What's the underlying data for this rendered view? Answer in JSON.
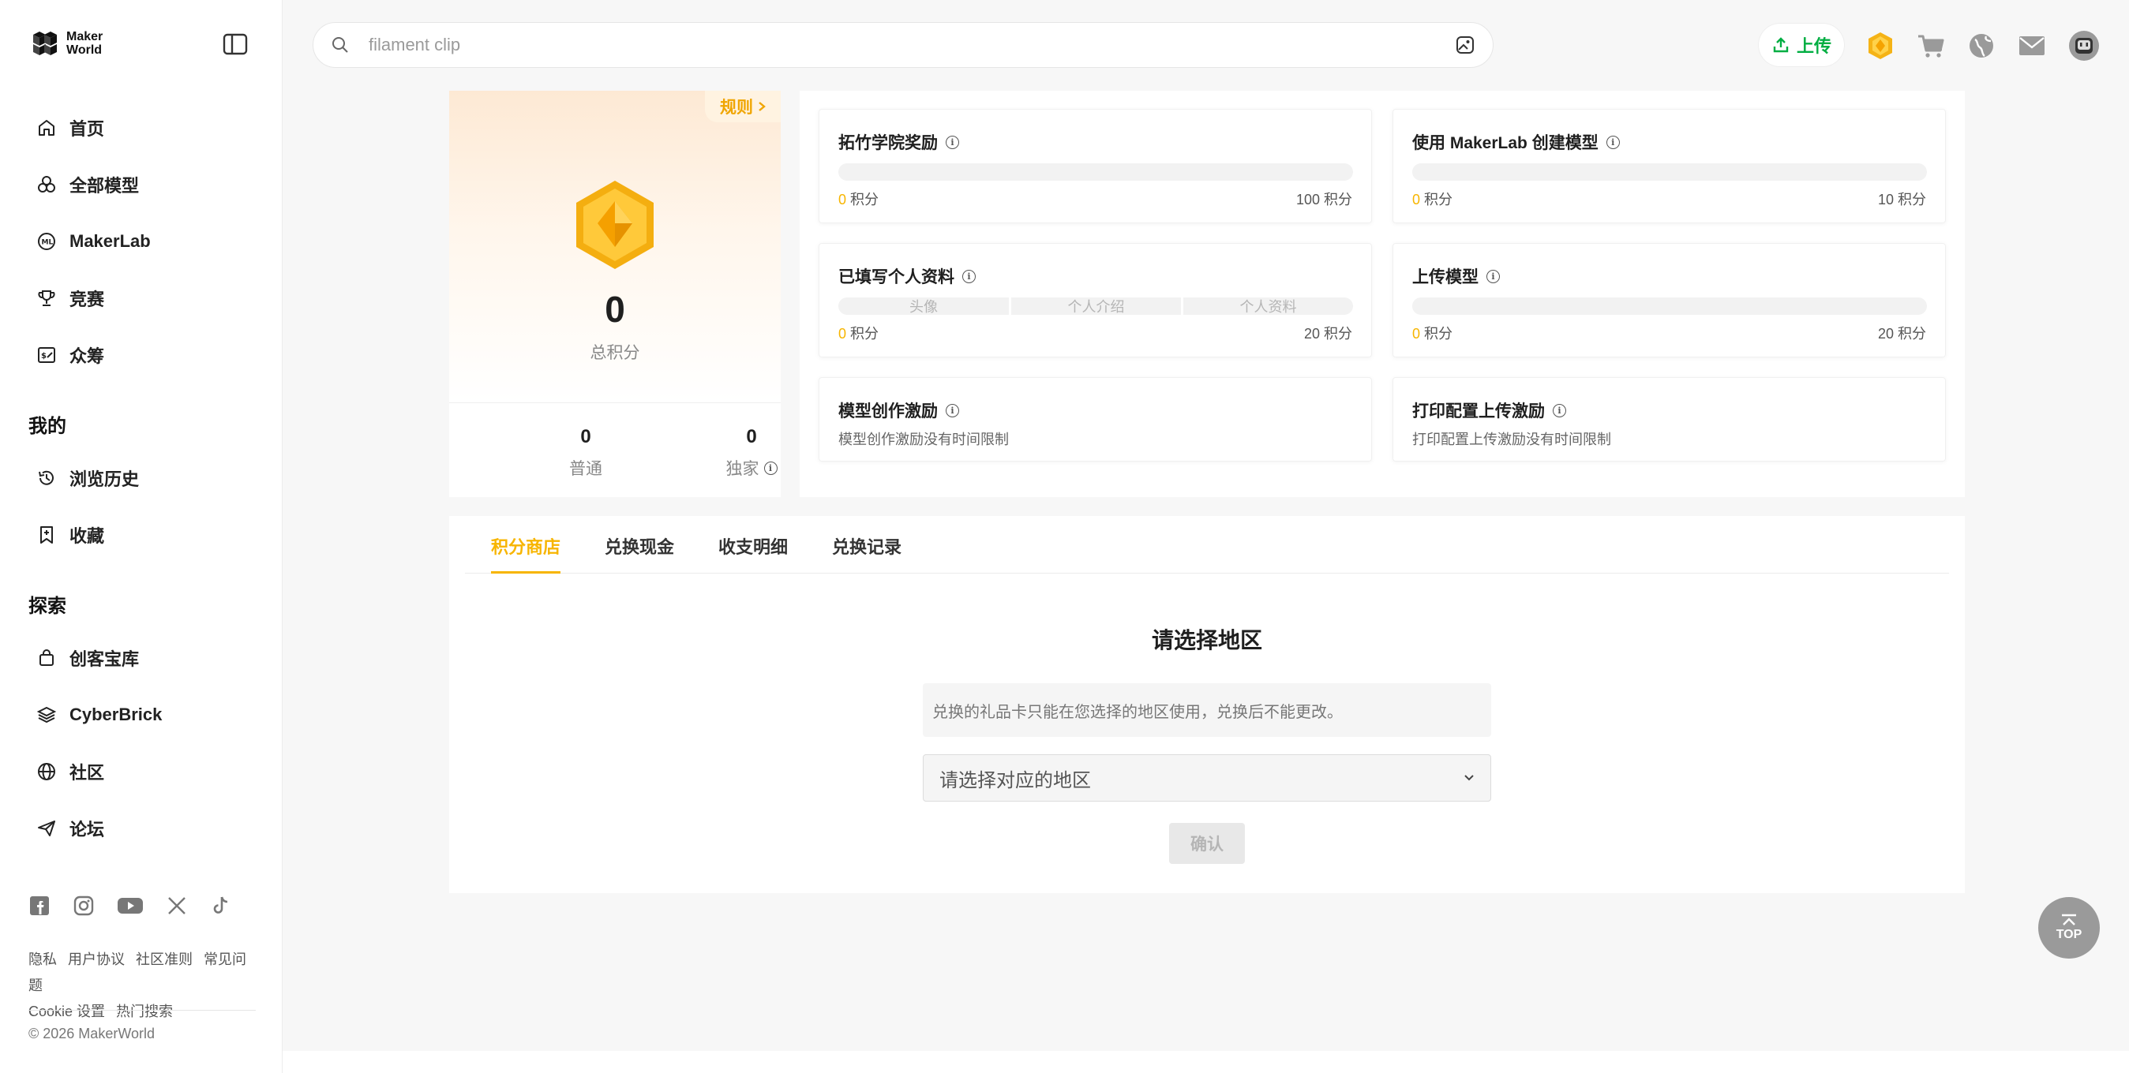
{
  "brand": {
    "logo_line1": "Maker",
    "logo_line2": "World",
    "accent": "#f7b500",
    "upload_color": "#00ae42"
  },
  "sidebar": {
    "nav": [
      {
        "label": "首页",
        "icon": "home-icon"
      },
      {
        "label": "全部模型",
        "icon": "models-icon"
      },
      {
        "label": "MakerLab",
        "icon": "makerlab-icon"
      },
      {
        "label": "竞赛",
        "icon": "trophy-icon"
      },
      {
        "label": "众筹",
        "icon": "crowdfund-icon"
      }
    ],
    "mine_title": "我的",
    "mine": [
      {
        "label": "浏览历史",
        "icon": "history-icon"
      },
      {
        "label": "收藏",
        "icon": "bookmark-icon"
      }
    ],
    "explore_title": "探索",
    "explore": [
      {
        "label": "创客宝库",
        "icon": "bag-icon"
      },
      {
        "label": "CyberBrick",
        "icon": "cyberbrick-icon"
      },
      {
        "label": "社区",
        "icon": "globe-icon"
      },
      {
        "label": "论坛",
        "icon": "send-icon"
      }
    ],
    "social": [
      "facebook-icon",
      "instagram-icon",
      "youtube-icon",
      "x-icon",
      "tiktok-icon"
    ],
    "footer_links": [
      "隐私",
      "用户协议",
      "社区准则",
      "常见问题",
      "Cookie 设置",
      "热门搜索"
    ],
    "copyright": "© 2026 MakerWorld"
  },
  "header": {
    "search_placeholder": "filament clip",
    "upload_label": "上传"
  },
  "points": {
    "rules_label": "规则",
    "total": "0",
    "total_label": "总积分",
    "regular_value": "0",
    "regular_label": "普通",
    "exclusive_value": "0",
    "exclusive_label": "独家"
  },
  "tasks": [
    {
      "title": "拓竹学院奖励",
      "min": "0",
      "unit": "积分",
      "max": "100 积分",
      "progress": 0
    },
    {
      "title": "使用 MakerLab 创建模型",
      "min": "0",
      "unit": "积分",
      "max": "10 积分",
      "progress": 0
    },
    {
      "title": "已填写个人资料",
      "min": "0",
      "unit": "积分",
      "max": "20 积分",
      "progress": 0,
      "segments": [
        "头像",
        "个人介绍",
        "个人资料"
      ]
    },
    {
      "title": "上传模型",
      "min": "0",
      "unit": "积分",
      "max": "20 积分",
      "progress": 0
    },
    {
      "title": "模型创作激励",
      "desc": "模型创作激励没有时间限制"
    },
    {
      "title": "打印配置上传激励",
      "desc": "打印配置上传激励没有时间限制"
    }
  ],
  "shop": {
    "tabs": [
      "积分商店",
      "兑换现金",
      "收支明细",
      "兑换记录"
    ],
    "region_title": "请选择地区",
    "region_note": "兑换的礼品卡只能在您选择的地区使用，兑换后不能更改。",
    "region_select": "请选择对应的地区",
    "confirm_label": "确认"
  },
  "top_button": "TOP"
}
